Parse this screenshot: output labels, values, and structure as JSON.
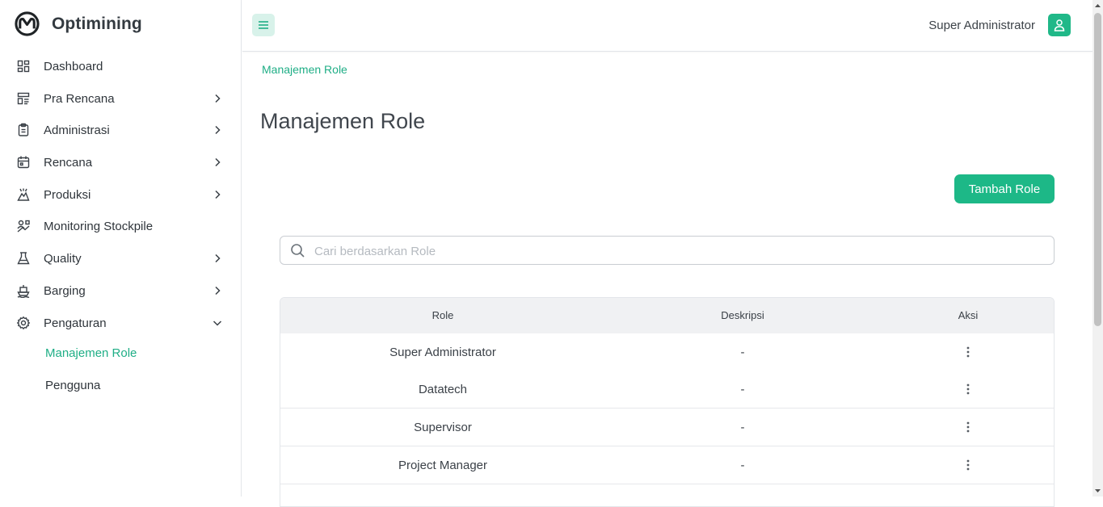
{
  "app": {
    "name": "Optimining"
  },
  "sidebar": {
    "items": [
      {
        "label": "Dashboard",
        "icon": "dashboard-icon",
        "has_chevron": false
      },
      {
        "label": "Pra Rencana",
        "icon": "layout-icon",
        "has_chevron": true
      },
      {
        "label": "Administrasi",
        "icon": "clipboard-icon",
        "has_chevron": true
      },
      {
        "label": "Rencana",
        "icon": "calendar-icon",
        "has_chevron": true
      },
      {
        "label": "Produksi",
        "icon": "production-icon",
        "has_chevron": true
      },
      {
        "label": "Monitoring Stockpile",
        "icon": "stockpile-icon",
        "has_chevron": false
      },
      {
        "label": "Quality",
        "icon": "flask-icon",
        "has_chevron": true
      },
      {
        "label": "Barging",
        "icon": "ship-icon",
        "has_chevron": true
      },
      {
        "label": "Pengaturan",
        "icon": "gear-icon",
        "has_chevron": true,
        "expanded": true
      }
    ],
    "subitems": [
      {
        "label": "Manajemen Role",
        "active": true
      },
      {
        "label": "Pengguna",
        "active": false
      }
    ]
  },
  "topbar": {
    "user_name": "Super Administrator"
  },
  "breadcrumb": "Manajemen Role",
  "page_title": "Manajemen Role",
  "add_button_label": "Tambah Role",
  "search": {
    "placeholder": "Cari berdasarkan Role",
    "value": ""
  },
  "table": {
    "headers": {
      "role": "Role",
      "description": "Deskripsi",
      "actions": "Aksi"
    },
    "rows": [
      {
        "role": "Super Administrator",
        "description": "-"
      },
      {
        "role": "Datatech",
        "description": "-"
      },
      {
        "role": "Supervisor",
        "description": "-"
      },
      {
        "role": "Project Manager",
        "description": "-"
      }
    ]
  },
  "colors": {
    "accent": "#1db887",
    "accent_light": "#d8f2ea",
    "active_text": "#1fae86"
  }
}
